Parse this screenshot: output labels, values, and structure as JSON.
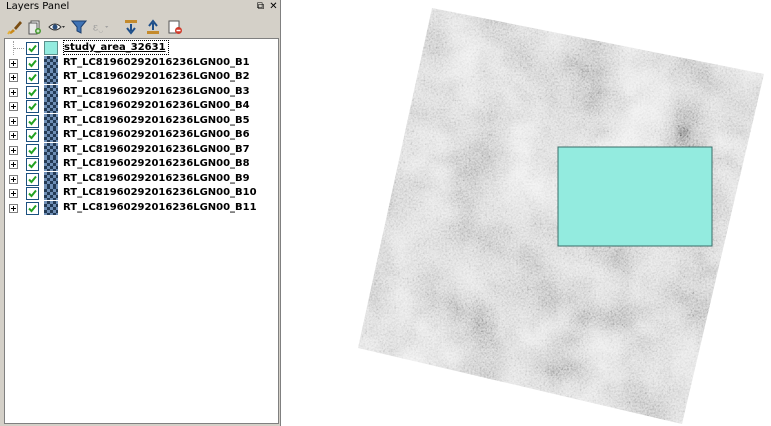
{
  "panel": {
    "title": "Layers Panel",
    "float_symbol": "⧉",
    "close_symbol": "✕"
  },
  "toolbar": {
    "buttons": [
      {
        "icon": "style-brush-icon"
      },
      {
        "icon": "add-group-icon"
      },
      {
        "icon": "visibility-eye-icon"
      },
      {
        "icon": "filter-icon"
      },
      {
        "icon": "filter-expression-icon"
      },
      {
        "icon": "expand-all-icon"
      },
      {
        "icon": "collapse-all-icon"
      },
      {
        "icon": "remove-layer-icon"
      }
    ]
  },
  "layers": [
    {
      "name": "study_area_32631",
      "type": "vector",
      "color": "#93ebdf",
      "checked": true,
      "selected": true
    },
    {
      "name": "RT_LC81960292016236LGN00_B1",
      "type": "raster",
      "checked": true
    },
    {
      "name": "RT_LC81960292016236LGN00_B2",
      "type": "raster",
      "checked": true
    },
    {
      "name": "RT_LC81960292016236LGN00_B3",
      "type": "raster",
      "checked": true
    },
    {
      "name": "RT_LC81960292016236LGN00_B4",
      "type": "raster",
      "checked": true
    },
    {
      "name": "RT_LC81960292016236LGN00_B5",
      "type": "raster",
      "checked": true
    },
    {
      "name": "RT_LC81960292016236LGN00_B6",
      "type": "raster",
      "checked": true
    },
    {
      "name": "RT_LC81960292016236LGN00_B7",
      "type": "raster",
      "checked": true
    },
    {
      "name": "RT_LC81960292016236LGN00_B8",
      "type": "raster",
      "checked": true
    },
    {
      "name": "RT_LC81960292016236LGN00_B9",
      "type": "raster",
      "checked": true
    },
    {
      "name": "RT_LC81960292016236LGN00_B10",
      "type": "raster",
      "checked": true
    },
    {
      "name": "RT_LC81960292016236LGN00_B11",
      "type": "raster",
      "checked": true
    }
  ],
  "map": {
    "study_area_color": "#93ebdf",
    "raster_dark": "#1a1a1a",
    "raster_light": "#f0f0f0"
  }
}
